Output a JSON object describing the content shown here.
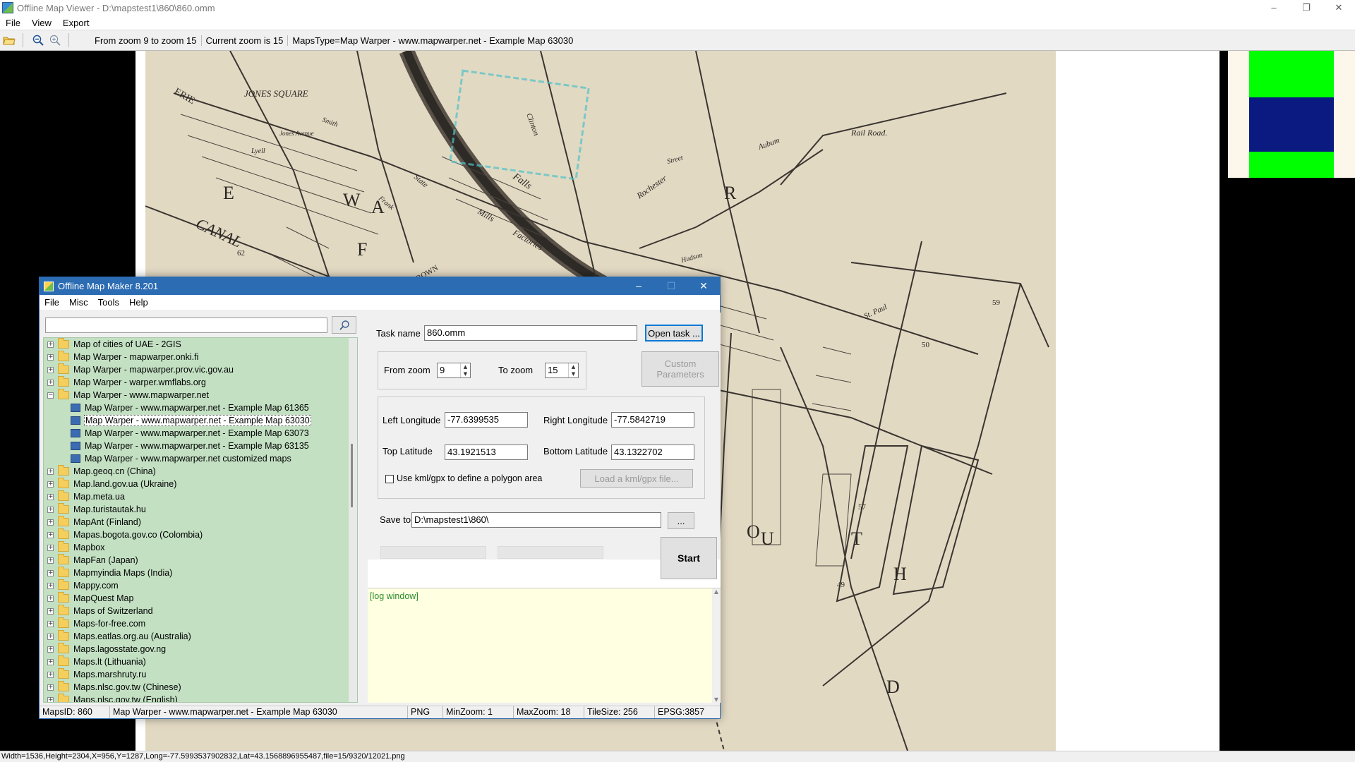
{
  "viewer": {
    "title": "Offline Map Viewer - D:\\mapstest1\\860\\860.omm",
    "menu": [
      "File",
      "View",
      "Export"
    ],
    "toolbar": {
      "zoom_range": "From zoom 9 to zoom 15",
      "current_zoom": "Current zoom is 15",
      "maps_type": "MapsType=Map Warper - www.mapwarper.net - Example Map 63030"
    },
    "status": "Width=1536,Height=2304,X=956,Y=1287,Long=-77.5993537902832,Lat=43.1568896955487,file=15/9320/12021.png",
    "map_labels": [
      "JONES SQUARE",
      "CANAL",
      "Falls",
      "Rail Road.",
      "Aubum",
      "Rochester",
      "Jones Avenue",
      "Smith",
      "Lyell",
      "State",
      "Frank",
      "Mills",
      "Factories",
      "St. Paul",
      "Clinton",
      "Hudson",
      "Street",
      "R",
      "A",
      "W",
      "F",
      "E",
      "O",
      "U",
      "T",
      "H",
      "D",
      "62",
      "57",
      "49",
      "50",
      "59",
      "ERIE",
      "BROWN"
    ]
  },
  "maker": {
    "title": "Offline Map Maker 8.201",
    "menu": [
      "File",
      "Misc",
      "Tools",
      "Help"
    ],
    "search": {
      "value": "",
      "placeholder": ""
    },
    "tree": [
      {
        "label": "Map of cities of UAE - 2GIS",
        "level": 0,
        "expanded": false
      },
      {
        "label": "Map Warper - mapwarper.onki.fi",
        "level": 0,
        "expanded": false
      },
      {
        "label": "Map Warper - mapwarper.prov.vic.gov.au",
        "level": 0,
        "expanded": false
      },
      {
        "label": "Map Warper - warper.wmflabs.org",
        "level": 0,
        "expanded": false
      },
      {
        "label": "Map Warper - www.mapwarper.net",
        "level": 0,
        "expanded": true
      },
      {
        "label": "Map Warper - www.mapwarper.net - Example Map 61365",
        "level": 1
      },
      {
        "label": "Map Warper - www.mapwarper.net - Example Map 63030",
        "level": 1,
        "selected": true
      },
      {
        "label": "Map Warper - www.mapwarper.net - Example Map 63073",
        "level": 1
      },
      {
        "label": "Map Warper - www.mapwarper.net - Example Map 63135",
        "level": 1
      },
      {
        "label": "Map Warper - www.mapwarper.net customized maps",
        "level": 1
      },
      {
        "label": "Map.geoq.cn (China)",
        "level": 0,
        "expanded": false
      },
      {
        "label": "Map.land.gov.ua (Ukraine)",
        "level": 0,
        "expanded": false
      },
      {
        "label": "Map.meta.ua",
        "level": 0,
        "expanded": false
      },
      {
        "label": "Map.turistautak.hu",
        "level": 0,
        "expanded": false
      },
      {
        "label": "MapAnt (Finland)",
        "level": 0,
        "expanded": false
      },
      {
        "label": "Mapas.bogota.gov.co (Colombia)",
        "level": 0,
        "expanded": false
      },
      {
        "label": "Mapbox",
        "level": 0,
        "expanded": false
      },
      {
        "label": "MapFan (Japan)",
        "level": 0,
        "expanded": false
      },
      {
        "label": "Mapmyindia Maps (India)",
        "level": 0,
        "expanded": false
      },
      {
        "label": "Mappy.com",
        "level": 0,
        "expanded": false
      },
      {
        "label": "MapQuest Map",
        "level": 0,
        "expanded": false
      },
      {
        "label": "Maps of Switzerland",
        "level": 0,
        "expanded": false
      },
      {
        "label": "Maps-for-free.com",
        "level": 0,
        "expanded": false
      },
      {
        "label": "Maps.eatlas.org.au (Australia)",
        "level": 0,
        "expanded": false
      },
      {
        "label": "Maps.lagosstate.gov.ng",
        "level": 0,
        "expanded": false
      },
      {
        "label": "Maps.lt (Lithuania)",
        "level": 0,
        "expanded": false
      },
      {
        "label": "Maps.marshruty.ru",
        "level": 0,
        "expanded": false
      },
      {
        "label": "Maps.nlsc.gov.tw (Chinese)",
        "level": 0,
        "expanded": false
      },
      {
        "label": "Maps.nlsc.gov.tw (English)",
        "level": 0,
        "expanded": false
      }
    ],
    "task": {
      "name_label": "Task name",
      "name_value": "860.omm",
      "open_task_label": "Open task ...",
      "from_zoom_label": "From zoom",
      "from_zoom_value": "9",
      "to_zoom_label": "To zoom",
      "to_zoom_value": "15",
      "custom_params_label": "Custom Parameters",
      "left_lon_label": "Left Longitude",
      "left_lon_value": "-77.6399535",
      "right_lon_label": "Right Longitude",
      "right_lon_value": "-77.5842719",
      "top_lat_label": "Top Latitude",
      "top_lat_value": "43.1921513",
      "bottom_lat_label": "Bottom Latitude",
      "bottom_lat_value": "43.1322702",
      "kml_checkbox_label": "Use kml/gpx to define a polygon area",
      "kml_checked": false,
      "load_kml_label": "Load a kml/gpx file...",
      "save_to_label": "Save to:",
      "save_to_value": "D:\\mapstest1\\860\\",
      "browse_label": "...",
      "start_label": "Start",
      "progress": [
        0,
        0,
        0
      ]
    },
    "log": "[log window]",
    "status": {
      "maps_id": "MapsID: 860",
      "map_name": "Map Warper - www.mapwarper.net - Example Map 63030",
      "format": "PNG",
      "min_zoom": "MinZoom: 1",
      "max_zoom": "MaxZoom: 18",
      "tile_size": "TileSize: 256",
      "epsg": "EPSG:3857"
    }
  },
  "colors": {
    "tree_bg": "#c3e0c3",
    "log_bg": "#ffffe1",
    "log_text": "#2a8a2a",
    "titlebar": "#2b6cb3",
    "map_paper": "#e2d9c3"
  }
}
